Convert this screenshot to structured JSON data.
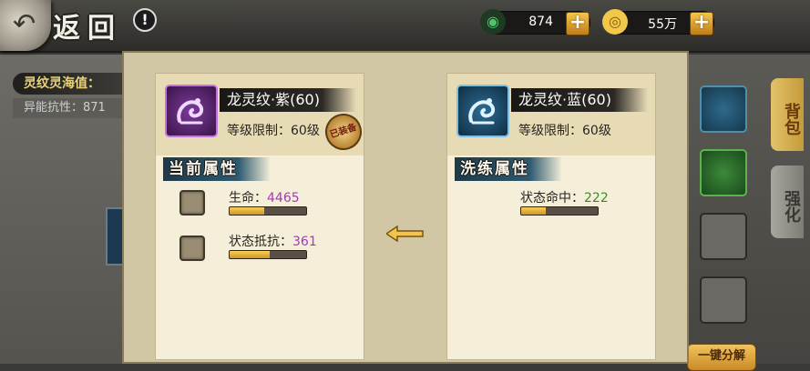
{
  "top_bar": {
    "back_label": "返回",
    "help_glyph": "!",
    "resources": [
      {
        "icon": "jade-icon",
        "value": "874",
        "color": "#4cc46a",
        "plus": "+"
      },
      {
        "icon": "coin-icon",
        "value": "55万",
        "color": "#f1c84a",
        "plus": "+"
      }
    ]
  },
  "left_info": {
    "title": "灵纹灵海值：",
    "stat": "异能抗性：871"
  },
  "side_tabs": [
    {
      "label": "背包"
    },
    {
      "label": "强化"
    }
  ],
  "bottom_right_button": "一键分解",
  "current": {
    "name": "龙灵纹·紫(60)",
    "level": "等级限制：60级",
    "seal": "已装备",
    "section": "当前属性",
    "frame_color": "#8a3bb0",
    "stats": [
      {
        "label": "生命：",
        "value": "4465",
        "fill": 0.45
      },
      {
        "label": "状态抵抗：",
        "value": "361",
        "fill": 0.52
      }
    ]
  },
  "refine": {
    "name": "龙灵纹·蓝(60)",
    "level": "等级限制：60级",
    "section": "洗练属性",
    "frame_color": "#3f86b5",
    "stats": [
      {
        "label": "状态命中：",
        "value": "222",
        "fill": 0.32
      }
    ]
  },
  "transfer_arrow": "left-arrow-icon"
}
